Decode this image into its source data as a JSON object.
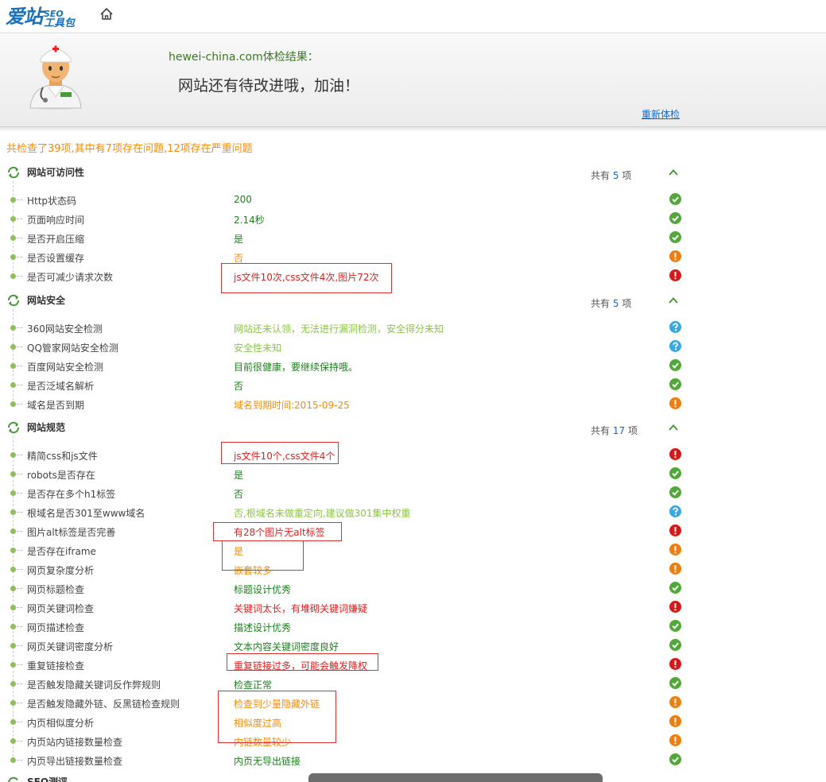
{
  "logo": {
    "main": "爱站",
    "seo": "SEO",
    "tool": "工具包"
  },
  "banner": {
    "site_line": "hewei-china.com体检结果：",
    "slogan": "网站还有待改进哦，加油！",
    "recheck": "重新体检"
  },
  "summary": "共检查了39项,其中有7项存在问题,12项存在严重问题",
  "colors": {
    "good": "#1e7e1e",
    "warn": "#f08c10",
    "bad": "#e02020",
    "info": "#8cc44a",
    "link": "#1a66c2"
  },
  "sections": [
    {
      "title": "网站可访问性",
      "count_prefix": "共有",
      "count": "5",
      "count_suffix": "项",
      "items": [
        {
          "label": "Http状态码",
          "value": "200",
          "status": "ok"
        },
        {
          "label": "页面响应时间",
          "value": "2.14秒",
          "status": "ok"
        },
        {
          "label": "是否开启压缩",
          "value": "是",
          "status": "ok"
        },
        {
          "label": "是否设置缓存",
          "value": "否",
          "status": "warn"
        },
        {
          "label": "是否可减少请求次数",
          "value": "js文件10次,css文件4次,图片72次",
          "status": "bad"
        }
      ]
    },
    {
      "title": "网站安全",
      "count_prefix": "共有",
      "count": "5",
      "count_suffix": "项",
      "items": [
        {
          "label": "360网站安全检测",
          "value": "网站还未认领，无法进行漏洞检测，安全得分未知",
          "status": "info"
        },
        {
          "label": "QQ管家网站安全检测",
          "value": "安全性未知",
          "status": "info"
        },
        {
          "label": "百度网站安全检测",
          "value": "目前很健康，要继续保持哦。",
          "status": "ok"
        },
        {
          "label": "是否泛域名解析",
          "value": "否",
          "status": "ok"
        },
        {
          "label": "域名是否到期",
          "value": "域名到期时间:2015-09-25",
          "status": "warn"
        }
      ]
    },
    {
      "title": "网站规范",
      "count_prefix": "共有",
      "count": "17",
      "count_suffix": "项",
      "items": [
        {
          "label": "精简css和js文件",
          "value": "js文件10个,css文件4个",
          "status": "bad"
        },
        {
          "label": "robots是否存在",
          "value": "是",
          "status": "ok"
        },
        {
          "label": "是否存在多个h1标签",
          "value": "否",
          "status": "ok"
        },
        {
          "label": "根域名是否301至www域名",
          "value": "否,根域名未做重定向,建议做301集中权重",
          "status": "info"
        },
        {
          "label": "图片alt标签是否完善",
          "value": "有28个图片无alt标签",
          "status": "bad"
        },
        {
          "label": "是否存在iframe",
          "value": "是",
          "status": "warn"
        },
        {
          "label": "网页复杂度分析",
          "value": "嵌套较多",
          "status": "warn"
        },
        {
          "label": "网页标题检查",
          "value": "标题设计优秀",
          "status": "ok"
        },
        {
          "label": "网页关键词检查",
          "value": "关键词太长，有堆砌关键词嫌疑",
          "status": "bad"
        },
        {
          "label": "网页描述检查",
          "value": "描述设计优秀",
          "status": "ok"
        },
        {
          "label": "网页关键词密度分析",
          "value": "文本内容关键词密度良好",
          "status": "ok"
        },
        {
          "label": "重复链接检查",
          "value": "重复链接过多，可能会触发降权",
          "status": "bad"
        },
        {
          "label": "是否触发隐藏关键词反作弊规则",
          "value": "检查正常",
          "status": "ok"
        },
        {
          "label": "是否触发隐藏外链、反黑链检查规则",
          "value": "检查到少量隐藏外链",
          "status": "warn"
        },
        {
          "label": "内页相似度分析",
          "value": "相似度过高",
          "status": "warn"
        },
        {
          "label": "内页站内链接数量检查",
          "value": "内链数量较少",
          "status": "warn"
        },
        {
          "label": "内页导出链接数量检查",
          "value": "内页无导出链接",
          "status": "ok"
        }
      ]
    }
  ],
  "next_section_title": "SEO测评"
}
